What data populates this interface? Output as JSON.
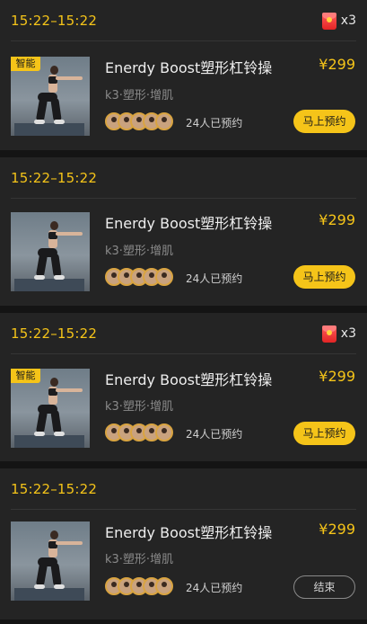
{
  "colors": {
    "accent": "#f5c419",
    "card": "#242424",
    "background": "#141414"
  },
  "cards": [
    {
      "time": "15:22–15:22",
      "reward": "x3",
      "smart_tag": "智能",
      "title": "Enerdy Boost塑形杠铃操",
      "price": "¥299",
      "tags": "k3·塑形·增肌",
      "booked": "24人已预约",
      "action": "马上预约",
      "action_state": "book"
    },
    {
      "time": "15:22–15:22",
      "reward": "",
      "smart_tag": "",
      "title": "Enerdy Boost塑形杠铃操",
      "price": "¥299",
      "tags": "k3·塑形·增肌",
      "booked": "24人已预约",
      "action": "马上预约",
      "action_state": "book"
    },
    {
      "time": "15:22–15:22",
      "reward": "x3",
      "smart_tag": "智能",
      "title": "Enerdy Boost塑形杠铃操",
      "price": "¥299",
      "tags": "k3·塑形·增肌",
      "booked": "24人已预约",
      "action": "马上预约",
      "action_state": "book"
    },
    {
      "time": "15:22–15:22",
      "reward": "",
      "smart_tag": "",
      "title": "Enerdy Boost塑形杠铃操",
      "price": "¥299",
      "tags": "k3·塑形·增肌",
      "booked": "24人已预约",
      "action": "结束",
      "action_state": "ended"
    }
  ]
}
